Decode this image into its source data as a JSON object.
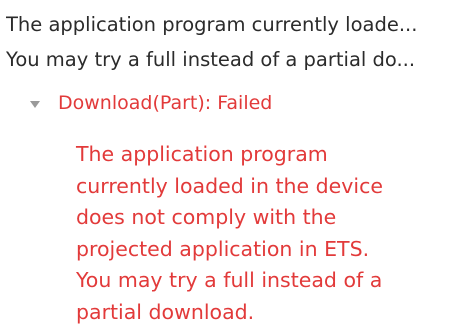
{
  "summary": {
    "line1": "The application program currently loade...",
    "line2": "You may try a full instead of a partial do..."
  },
  "status": {
    "label": "Download(Part): Failed",
    "chevron_icon": "chevron-down-icon",
    "color": "#e23a3a"
  },
  "detail": {
    "lines": [
      "The application program",
      "currently loaded in the device",
      "does not comply with the",
      "projected application in ETS.",
      "You may try a full instead of a",
      "partial download."
    ]
  }
}
